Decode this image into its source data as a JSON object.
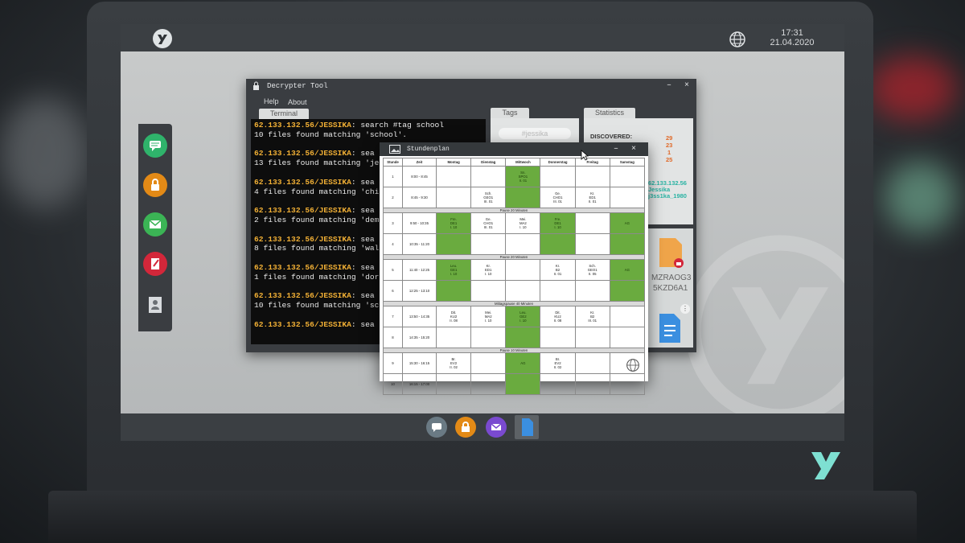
{
  "os": {
    "time": "17:31",
    "date": "21.04.2020"
  },
  "icons": {
    "sidebar": [
      "chat-icon",
      "lock-icon",
      "mail-icon",
      "notes-icon",
      "contact-icon"
    ],
    "dock": [
      "chat-icon",
      "lock-icon",
      "mail-icon",
      "document-icon"
    ]
  },
  "colors": {
    "terminal_prompt": "#f2b035",
    "accent_green": "#6aab3f",
    "discovered_numbers": "#e06a2a",
    "stat_cyan": "#2ab3a3"
  },
  "decrypter": {
    "title": "Decrypter Tool",
    "menu": [
      "Help",
      "About"
    ],
    "tabs": [
      "Terminal",
      "Tags",
      "Statistics"
    ],
    "terminal_lines": [
      {
        "prompt": "62.133.132.56/JESSIKA",
        "text": ": search #tag school"
      },
      {
        "prompt": "",
        "text": "10 files found matching 'school'."
      },
      {
        "prompt": "",
        "text": ""
      },
      {
        "prompt": "62.133.132.56/JESSIKA",
        "text": ": sea"
      },
      {
        "prompt": "",
        "text": "13 files found matching 'je"
      },
      {
        "prompt": "",
        "text": ""
      },
      {
        "prompt": "62.133.132.56/JESSIKA",
        "text": ": sea"
      },
      {
        "prompt": "",
        "text": "4 files found matching 'chi"
      },
      {
        "prompt": "",
        "text": ""
      },
      {
        "prompt": "62.133.132.56/JESSIKA",
        "text": ": sea"
      },
      {
        "prompt": "",
        "text": "2 files found matching 'dem"
      },
      {
        "prompt": "",
        "text": ""
      },
      {
        "prompt": "62.133.132.56/JESSIKA",
        "text": ": sea"
      },
      {
        "prompt": "",
        "text": "8 files found matching 'wal"
      },
      {
        "prompt": "",
        "text": ""
      },
      {
        "prompt": "62.133.132.56/JESSIKA",
        "text": ": sea"
      },
      {
        "prompt": "",
        "text": "1 files found matching 'dor"
      },
      {
        "prompt": "",
        "text": ""
      },
      {
        "prompt": "62.133.132.56/JESSIKA",
        "text": ": sea"
      },
      {
        "prompt": "",
        "text": "10 files found matching 'sc"
      },
      {
        "prompt": "",
        "text": ""
      },
      {
        "prompt": "62.133.132.56/JESSIKA",
        "text": ": sea"
      }
    ],
    "tag_value": "#jessika",
    "stats": {
      "discovered_label": "DISCOVERED:",
      "numbers": [
        "29",
        "23",
        "1",
        "25"
      ],
      "ip": "62.133.132.56",
      "user": "Jessika",
      "handle": "j3ss1ka_1980"
    },
    "file_name_line1": "MZRAOG3",
    "file_name_line2": "5KZD6A1"
  },
  "stundenplan": {
    "title": "Stundenplan",
    "headers": [
      "Stunde",
      "Zeit",
      "Montag",
      "Dienstag",
      "Mittwoch",
      "Donnerstag",
      "Freitag",
      "Samstag"
    ],
    "rows": [
      {
        "type": "lesson",
        "stunde": "1",
        "zeit": "8:00 - 8:45",
        "cells": [
          "",
          "",
          "Sn.\nSPO1\nII. 01",
          "",
          "",
          ""
        ]
      },
      {
        "type": "lesson",
        "stunde": "2",
        "zeit": "8:45 - 9:30",
        "cells": [
          "",
          "Sch.\nGEO1\nIII. 01",
          "",
          "Ge.\nCHO1\nIII. 01",
          "Kr.\nED1\nII. 01",
          ""
        ]
      },
      {
        "type": "pause",
        "label": "Pause 20 Minuten"
      },
      {
        "type": "lesson",
        "stunde": "3",
        "zeit": "9:50 - 10:35",
        "cells": [
          "Fre.\nDE1\nI. 10",
          "Ge.\nCHO1\nIII. 01",
          "Mei.\nMA2\nI. 10",
          "Fre.\nDE1\nI. 10",
          "",
          "AG"
        ]
      },
      {
        "type": "lesson",
        "stunde": "4",
        "zeit": "10:35 - 11:20",
        "cells": [
          "",
          "",
          "",
          "",
          "",
          ""
        ]
      },
      {
        "type": "pause",
        "label": "Pause 20 Minuten"
      },
      {
        "type": "lesson",
        "stunde": "5",
        "zeit": "11:40 - 12:25",
        "cells": [
          "Leu.\nGE1\nI. 10",
          "Kr.\nED1\nI. 10",
          "",
          "Kr.\nB2\nII. 01",
          "Sch.\nGEO1\nII. 05",
          "AG"
        ]
      },
      {
        "type": "lesson",
        "stunde": "6",
        "zeit": "12:25 - 13:10",
        "cells": [
          "",
          "",
          "",
          "",
          "",
          ""
        ]
      },
      {
        "type": "pause",
        "label": "Mittagspause 40 Minuten"
      },
      {
        "type": "lesson",
        "stunde": "7",
        "zeit": "13:50 - 14:35",
        "cells": [
          "Dit.\nKU2\nII. 08",
          "Mei.\nMA2\nI. 10",
          "Leu.\nGE2\nI. 10",
          "Dit.\nKU2\nII. 08",
          "Kr.\nB2\nIII. 01",
          ""
        ]
      },
      {
        "type": "lesson",
        "stunde": "8",
        "zeit": "14:35 - 15:20",
        "cells": [
          "",
          "",
          "",
          "",
          "",
          ""
        ]
      },
      {
        "type": "pause",
        "label": "Pause 10 Minuten"
      },
      {
        "type": "lesson",
        "stunde": "9",
        "zeit": "15:30 - 16:15",
        "cells": [
          "Br.\nEV2\nII. 02",
          "",
          "AG",
          "Br.\nEV2\nII. 02",
          "",
          ""
        ]
      },
      {
        "type": "lesson",
        "stunde": "10",
        "zeit": "16:15 - 17:00",
        "cells": [
          "",
          "",
          "",
          "",
          "",
          ""
        ]
      }
    ]
  }
}
